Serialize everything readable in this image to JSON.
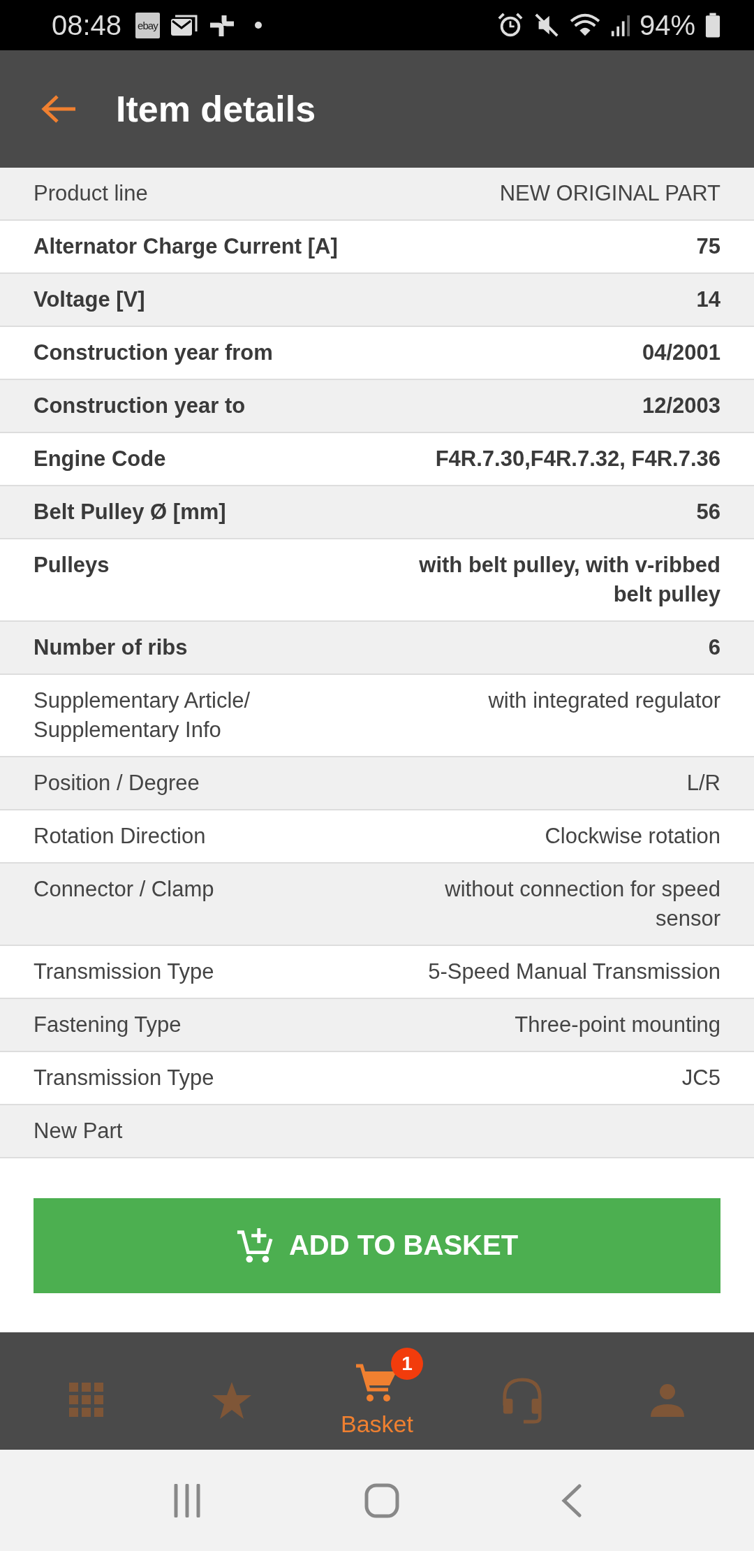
{
  "status_bar": {
    "time": "08:48",
    "notification_badge": "ebay",
    "battery": "94%"
  },
  "header": {
    "title": "Item details"
  },
  "details": [
    {
      "label": "Product line",
      "value": "NEW ORIGINAL PART",
      "emphasized": false
    },
    {
      "label": "Alternator Charge Current [A]",
      "value": "75",
      "emphasized": true
    },
    {
      "label": "Voltage [V]",
      "value": "14",
      "emphasized": true
    },
    {
      "label": "Construction year from",
      "value": "04/2001",
      "emphasized": true
    },
    {
      "label": "Construction year to",
      "value": "12/2003",
      "emphasized": true
    },
    {
      "label": "Engine Code",
      "value": "F4R.7.30,F4R.7.32, F4R.7.36",
      "emphasized": true
    },
    {
      "label": "Belt Pulley Ø [mm]",
      "value": "56",
      "emphasized": true
    },
    {
      "label": "Pulleys",
      "value": "with belt pulley, with v-ribbed belt pulley",
      "emphasized": true
    },
    {
      "label": "Number of ribs",
      "value": "6",
      "emphasized": true
    },
    {
      "label": "Supplementary Article/ Supplementary Info",
      "value": "with integrated regulator",
      "emphasized": false
    },
    {
      "label": "Position / Degree",
      "value": "L/R",
      "emphasized": false
    },
    {
      "label": "Rotation Direction",
      "value": "Clockwise rotation",
      "emphasized": false
    },
    {
      "label": "Connector / Clamp",
      "value": "without connection for speed sensor",
      "emphasized": false
    },
    {
      "label": "Transmission Type",
      "value": "5-Speed Manual Transmission",
      "emphasized": false
    },
    {
      "label": "Fastening Type",
      "value": "Three-point mounting",
      "emphasized": false
    },
    {
      "label": "Transmission Type",
      "value": "JC5",
      "emphasized": false
    },
    {
      "label": "New Part",
      "emphasized": false
    }
  ],
  "add_button": {
    "label": "ADD TO BASKET"
  },
  "bottom_nav": [
    {
      "kind": "grid",
      "selected": false
    },
    {
      "kind": "star",
      "selected": false
    },
    {
      "kind": "cart",
      "selected": true,
      "label": "Basket",
      "badge": "1"
    },
    {
      "kind": "headset",
      "selected": false
    },
    {
      "kind": "person",
      "selected": false
    }
  ]
}
